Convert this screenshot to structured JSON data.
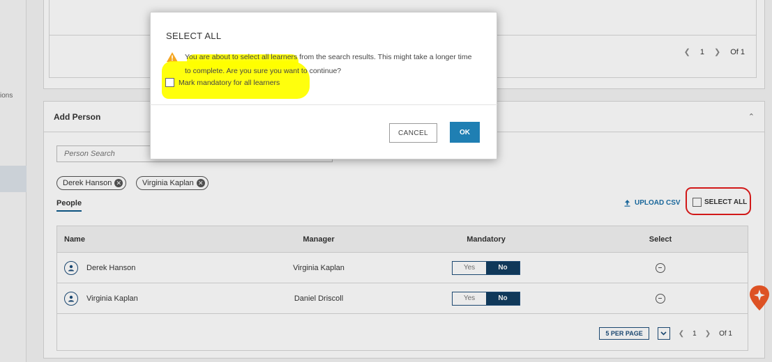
{
  "nav": {
    "partial_label": "ions"
  },
  "top_section": {
    "pager": {
      "current": "1",
      "total": "Of 1"
    }
  },
  "add_person": {
    "title": "Add Person",
    "search_placeholder": "Person Search",
    "chips": [
      {
        "label": "Derek Hanson"
      },
      {
        "label": "Virginia Kaplan"
      }
    ],
    "tab_label": "People",
    "upload_label": "UPLOAD CSV",
    "select_all_label": "SELECT ALL",
    "table": {
      "headers": {
        "name": "Name",
        "manager": "Manager",
        "mandatory": "Mandatory",
        "select": "Select"
      },
      "rows": [
        {
          "name": "Derek Hanson",
          "manager": "Virginia Kaplan",
          "yes": "Yes",
          "no": "No"
        },
        {
          "name": "Virginia Kaplan",
          "manager": "Daniel Driscoll",
          "yes": "Yes",
          "no": "No"
        }
      ]
    },
    "pagination": {
      "per_page": "5 PER PAGE",
      "current": "1",
      "total": "Of 1"
    }
  },
  "modal": {
    "title": "SELECT ALL",
    "message": "You are about to select all learners from the search results. This might take a longer time to complete. Are you sure you want to continue?",
    "checkbox_label": "Mark mandatory for all learners",
    "cancel_label": "CANCEL",
    "ok_label": "OK"
  },
  "colors": {
    "accent": "#1f7fb3",
    "toggle_active": "#123d61",
    "highlight": "#ffff00",
    "annotation": "#e31b1b",
    "warning": "#f5a623",
    "fab": "#f05a28"
  }
}
